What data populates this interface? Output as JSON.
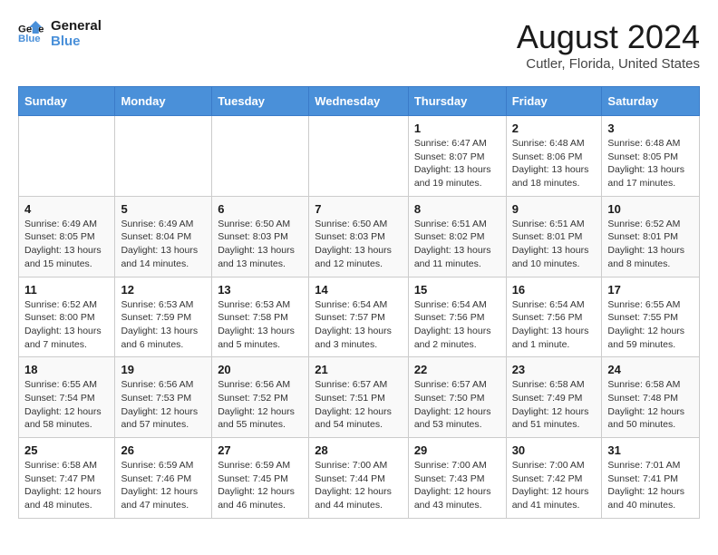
{
  "logo": {
    "line1": "General",
    "line2": "Blue"
  },
  "title": "August 2024",
  "subtitle": "Cutler, Florida, United States",
  "days_of_week": [
    "Sunday",
    "Monday",
    "Tuesday",
    "Wednesday",
    "Thursday",
    "Friday",
    "Saturday"
  ],
  "weeks": [
    [
      {
        "day": "",
        "info": ""
      },
      {
        "day": "",
        "info": ""
      },
      {
        "day": "",
        "info": ""
      },
      {
        "day": "",
        "info": ""
      },
      {
        "day": "1",
        "info": "Sunrise: 6:47 AM\nSunset: 8:07 PM\nDaylight: 13 hours\nand 19 minutes."
      },
      {
        "day": "2",
        "info": "Sunrise: 6:48 AM\nSunset: 8:06 PM\nDaylight: 13 hours\nand 18 minutes."
      },
      {
        "day": "3",
        "info": "Sunrise: 6:48 AM\nSunset: 8:05 PM\nDaylight: 13 hours\nand 17 minutes."
      }
    ],
    [
      {
        "day": "4",
        "info": "Sunrise: 6:49 AM\nSunset: 8:05 PM\nDaylight: 13 hours\nand 15 minutes."
      },
      {
        "day": "5",
        "info": "Sunrise: 6:49 AM\nSunset: 8:04 PM\nDaylight: 13 hours\nand 14 minutes."
      },
      {
        "day": "6",
        "info": "Sunrise: 6:50 AM\nSunset: 8:03 PM\nDaylight: 13 hours\nand 13 minutes."
      },
      {
        "day": "7",
        "info": "Sunrise: 6:50 AM\nSunset: 8:03 PM\nDaylight: 13 hours\nand 12 minutes."
      },
      {
        "day": "8",
        "info": "Sunrise: 6:51 AM\nSunset: 8:02 PM\nDaylight: 13 hours\nand 11 minutes."
      },
      {
        "day": "9",
        "info": "Sunrise: 6:51 AM\nSunset: 8:01 PM\nDaylight: 13 hours\nand 10 minutes."
      },
      {
        "day": "10",
        "info": "Sunrise: 6:52 AM\nSunset: 8:01 PM\nDaylight: 13 hours\nand 8 minutes."
      }
    ],
    [
      {
        "day": "11",
        "info": "Sunrise: 6:52 AM\nSunset: 8:00 PM\nDaylight: 13 hours\nand 7 minutes."
      },
      {
        "day": "12",
        "info": "Sunrise: 6:53 AM\nSunset: 7:59 PM\nDaylight: 13 hours\nand 6 minutes."
      },
      {
        "day": "13",
        "info": "Sunrise: 6:53 AM\nSunset: 7:58 PM\nDaylight: 13 hours\nand 5 minutes."
      },
      {
        "day": "14",
        "info": "Sunrise: 6:54 AM\nSunset: 7:57 PM\nDaylight: 13 hours\nand 3 minutes."
      },
      {
        "day": "15",
        "info": "Sunrise: 6:54 AM\nSunset: 7:56 PM\nDaylight: 13 hours\nand 2 minutes."
      },
      {
        "day": "16",
        "info": "Sunrise: 6:54 AM\nSunset: 7:56 PM\nDaylight: 13 hours\nand 1 minute."
      },
      {
        "day": "17",
        "info": "Sunrise: 6:55 AM\nSunset: 7:55 PM\nDaylight: 12 hours\nand 59 minutes."
      }
    ],
    [
      {
        "day": "18",
        "info": "Sunrise: 6:55 AM\nSunset: 7:54 PM\nDaylight: 12 hours\nand 58 minutes."
      },
      {
        "day": "19",
        "info": "Sunrise: 6:56 AM\nSunset: 7:53 PM\nDaylight: 12 hours\nand 57 minutes."
      },
      {
        "day": "20",
        "info": "Sunrise: 6:56 AM\nSunset: 7:52 PM\nDaylight: 12 hours\nand 55 minutes."
      },
      {
        "day": "21",
        "info": "Sunrise: 6:57 AM\nSunset: 7:51 PM\nDaylight: 12 hours\nand 54 minutes."
      },
      {
        "day": "22",
        "info": "Sunrise: 6:57 AM\nSunset: 7:50 PM\nDaylight: 12 hours\nand 53 minutes."
      },
      {
        "day": "23",
        "info": "Sunrise: 6:58 AM\nSunset: 7:49 PM\nDaylight: 12 hours\nand 51 minutes."
      },
      {
        "day": "24",
        "info": "Sunrise: 6:58 AM\nSunset: 7:48 PM\nDaylight: 12 hours\nand 50 minutes."
      }
    ],
    [
      {
        "day": "25",
        "info": "Sunrise: 6:58 AM\nSunset: 7:47 PM\nDaylight: 12 hours\nand 48 minutes."
      },
      {
        "day": "26",
        "info": "Sunrise: 6:59 AM\nSunset: 7:46 PM\nDaylight: 12 hours\nand 47 minutes."
      },
      {
        "day": "27",
        "info": "Sunrise: 6:59 AM\nSunset: 7:45 PM\nDaylight: 12 hours\nand 46 minutes."
      },
      {
        "day": "28",
        "info": "Sunrise: 7:00 AM\nSunset: 7:44 PM\nDaylight: 12 hours\nand 44 minutes."
      },
      {
        "day": "29",
        "info": "Sunrise: 7:00 AM\nSunset: 7:43 PM\nDaylight: 12 hours\nand 43 minutes."
      },
      {
        "day": "30",
        "info": "Sunrise: 7:00 AM\nSunset: 7:42 PM\nDaylight: 12 hours\nand 41 minutes."
      },
      {
        "day": "31",
        "info": "Sunrise: 7:01 AM\nSunset: 7:41 PM\nDaylight: 12 hours\nand 40 minutes."
      }
    ]
  ]
}
